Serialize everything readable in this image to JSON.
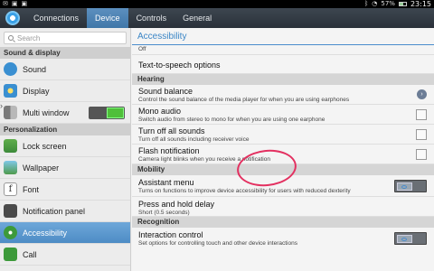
{
  "statusbar": {
    "battery": "57%",
    "time": "23:15"
  },
  "tabs": [
    {
      "label": "Connections"
    },
    {
      "label": "Device"
    },
    {
      "label": "Controls"
    },
    {
      "label": "General"
    }
  ],
  "sidebar": {
    "search_placeholder": "Search",
    "sections": [
      {
        "header": "Sound & display",
        "items": [
          {
            "label": "Sound",
            "icon": "speaker-icon"
          },
          {
            "label": "Display",
            "icon": "display-icon"
          },
          {
            "label": "Multi window",
            "icon": "multi-window-icon",
            "toggle": "on"
          }
        ]
      },
      {
        "header": "Personalization",
        "items": [
          {
            "label": "Lock screen",
            "icon": "lock-screen-icon"
          },
          {
            "label": "Wallpaper",
            "icon": "wallpaper-icon"
          },
          {
            "label": "Font",
            "icon": "font-icon"
          },
          {
            "label": "Notification panel",
            "icon": "notification-panel-icon"
          },
          {
            "label": "Accessibility",
            "icon": "accessibility-icon",
            "selected": true
          },
          {
            "label": "Call",
            "icon": "call-icon"
          }
        ]
      }
    ]
  },
  "main": {
    "title": "Accessibility",
    "rows": [
      {
        "kind": "partial",
        "subtitle": "Off"
      },
      {
        "kind": "item",
        "title": "Text-to-speech options"
      },
      {
        "kind": "group",
        "title": "Hearing"
      },
      {
        "kind": "item",
        "title": "Sound balance",
        "subtitle": "Control the sound balance of the media player for when you are using earphones",
        "control": "arrow"
      },
      {
        "kind": "item",
        "title": "Mono audio",
        "subtitle": "Switch audio from stereo to mono for when you are using one earphone",
        "control": "checkbox"
      },
      {
        "kind": "item",
        "title": "Turn off all sounds",
        "subtitle": "Turn off all sounds including receiver voice",
        "control": "checkbox"
      },
      {
        "kind": "item",
        "title": "Flash notification",
        "subtitle": "Camera light blinks when you receive a notification",
        "control": "checkbox"
      },
      {
        "kind": "group",
        "title": "Mobility"
      },
      {
        "kind": "item",
        "title": "Assistant menu",
        "subtitle": "Turns on functions to improve device accessibility for users with reduced dexterity",
        "control": "toggle"
      },
      {
        "kind": "item",
        "title": "Press and hold delay",
        "subtitle": "Short (0.5 seconds)"
      },
      {
        "kind": "group",
        "title": "Recognition"
      },
      {
        "kind": "item",
        "title": "Interaction control",
        "subtitle": "Set options for controlling touch and other device interactions",
        "control": "toggle"
      }
    ]
  },
  "colors": {
    "accent": "#3b86c6",
    "annotation": "#e33060",
    "toggle_on": "#4fbf3a"
  }
}
